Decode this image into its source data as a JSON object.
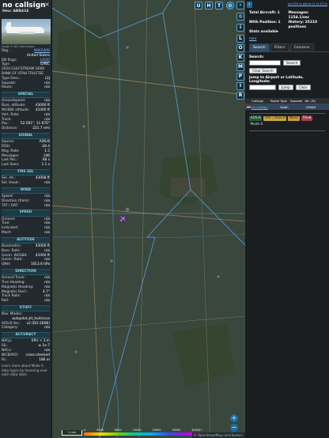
{
  "infoblock": {
    "callsign": "no callsign",
    "hex_label": "Hex:",
    "hex": "ABB41E",
    "close_glyph": "×",
    "photo_credit": "Image © W2 Uhlenhorpen",
    "rows_top": [
      {
        "k": "Reg.:",
        "v": "N962WW",
        "link": true
      },
      {
        "k": "",
        "v": "United States"
      },
      {
        "k": "DB flags:",
        "v": "LADD",
        "link": true
      },
      {
        "k": "Type",
        "v": "GA6C"
      },
      {
        "k": "2020 GULFSTREAM G600",
        "v": ""
      },
      {
        "k": "BANK OF UTAH TRUSTEE",
        "v": ""
      },
      {
        "k": "Type Desc.:",
        "v": "L2J"
      },
      {
        "k": "Squawk:",
        "v": "n/a"
      },
      {
        "k": "Route:",
        "v": "n/a"
      }
    ],
    "sections": [
      {
        "title": "SPATIAL",
        "rows": [
          {
            "k": "Groundspeed:",
            "v": "n/a"
          },
          {
            "k": "Baro. altitude:",
            "v": "43000 ft"
          },
          {
            "k": "WGS84 altitude:",
            "v": "43300 ft"
          },
          {
            "k": "Vert. Rate:",
            "v": "n/a"
          },
          {
            "k": "Track:",
            "v": "n/a"
          },
          {
            "k": "Pos.:",
            "v": "52.591°, 11.970°"
          },
          {
            "k": "Distance:",
            "v": "221.7 nmi"
          }
        ]
      },
      {
        "title": "SIGNAL",
        "rows": [
          {
            "k": "Source:",
            "v": "ADS-B"
          },
          {
            "k": "RSSI:",
            "v": "-28.4"
          },
          {
            "k": "Msg. Rate:",
            "v": "1.5"
          },
          {
            "k": "Messages:",
            "v": "146"
          },
          {
            "k": "Last Pos.:",
            "v": "68 s"
          },
          {
            "k": "Last Seen:",
            "v": "1.1 s"
          }
        ]
      },
      {
        "title": "FMS SEL",
        "rows": [
          {
            "k": "Sel. Alt.:",
            "v": "43008 ft"
          },
          {
            "k": "Sel. Head.:",
            "v": "n/a"
          }
        ]
      },
      {
        "title": "WIND",
        "rows": [
          {
            "k": "Speed:",
            "v": "n/a"
          },
          {
            "k": "Direction (from):",
            "v": "n/a"
          },
          {
            "k": "TAT / OAT:",
            "v": "n/a"
          }
        ]
      },
      {
        "title": "SPEED",
        "rows": [
          {
            "k": "Ground:",
            "v": "n/a"
          },
          {
            "k": "True:",
            "v": "n/a"
          },
          {
            "k": "Indicated:",
            "v": "n/a"
          },
          {
            "k": "Mach:",
            "v": "n/a"
          }
        ]
      },
      {
        "title": "ALTITUDE",
        "rows": [
          {
            "k": "Barometric:",
            "v": "43000 ft"
          },
          {
            "k": "Baro. Rate:",
            "v": "n/a"
          },
          {
            "k": "Geom. WGS84:",
            "v": "43300 ft"
          },
          {
            "k": "Geom. Rate:",
            "v": "n/a"
          },
          {
            "k": "QNH:",
            "v": "1013.6 hPa"
          }
        ]
      },
      {
        "title": "DIRECTION",
        "rows": [
          {
            "k": "Ground Track:",
            "v": "n/a"
          },
          {
            "k": "True Heading:",
            "v": "n/a"
          },
          {
            "k": "Magnetic Heading:",
            "v": "n/a"
          },
          {
            "k": "Magnetic Decl.:",
            "v": "4.7°"
          },
          {
            "k": "Track Rate:",
            "v": "n/a"
          },
          {
            "k": "Roll:",
            "v": "n/a"
          }
        ]
      },
      {
        "title": "STUFF",
        "rows": [
          {
            "k": "Nav. Modes:",
            "v": ""
          },
          {
            "k": "",
            "v": "autopilot,alt_hold,tcas"
          },
          {
            "k": "ADS-B Ver.:",
            "v": "v2 (DO-260B)"
          },
          {
            "k": "Category:",
            "v": "n/a"
          }
        ]
      },
      {
        "title": "ACCURACY",
        "rows": [
          {
            "k": "NACp:",
            "v": "EPU < 3 m"
          },
          {
            "k": "SIL:",
            "v": "≤ 1e-7"
          },
          {
            "k": "NACv:",
            "v": "n/a"
          },
          {
            "k": "NICBARO:",
            "v": "cross-checked"
          },
          {
            "k": "Rc:",
            "v": "186 m"
          }
        ]
      }
    ],
    "footer": "Learn more about Mode S data types by hovering over each data label."
  },
  "map": {
    "top_buttons": [
      "U",
      "H",
      "T"
    ],
    "scale_label": "1 nmi",
    "attribution": "© OpenStreetMap contributors.",
    "legend_labels": [
      "0",
      "4000",
      "8000",
      "10000",
      "20000",
      "30000",
      "40000+"
    ],
    "zoom_in": "+",
    "zoom_out": "−"
  },
  "right_buttons": [
    "L",
    "O",
    "K",
    "M",
    "P",
    "I",
    "R"
  ],
  "panel": {
    "nav_glyph": "›",
    "git_link": "tar1090 on github (3.14.1274)",
    "stats": [
      {
        "k": "Total Aircraft: 1",
        "v": "Messages: 1154.1/sec"
      },
      {
        "k": "With Position: 1",
        "v": "History: 25210 positions"
      },
      {
        "k": "Stats available",
        "v": ""
      }
    ],
    "stats_link": "here",
    "tabs": [
      "Search",
      "Filters",
      "Columns"
    ],
    "search_label": "Search:",
    "search_button": "Search",
    "clear_button": "Clear Search",
    "jump_label": "Jump to Airport or Latitude, Longitude:",
    "jump_button": "Jump",
    "jump_clear": "Clear",
    "table_headers": [
      "",
      "Callsign",
      "Route",
      "Type",
      "Squawk",
      "Alt. (ft)"
    ],
    "table_row": {
      "callsign": "no callsign",
      "route": "",
      "type": "GA6C",
      "squawk": "",
      "alt": "43000"
    },
    "filters": [
      "ADS-B",
      "UAT / ADS-R",
      "MLAT",
      "TIS-B",
      "Mode-S"
    ],
    "colors": {
      "accent": "#1a6ea3",
      "aircraft": "#c070ff"
    }
  }
}
